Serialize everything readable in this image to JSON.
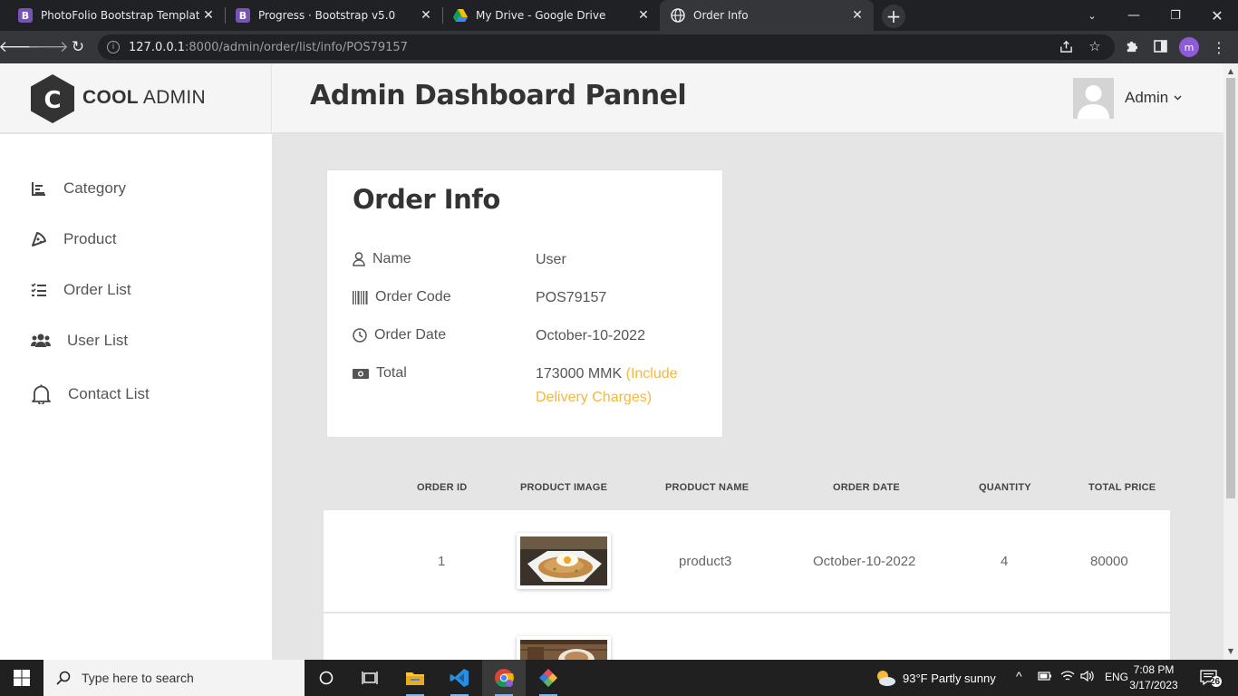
{
  "browser": {
    "tabs": [
      {
        "title": "PhotoFolio Bootstrap Template -",
        "icon": "bootstrap-icon",
        "favicon_letter": "B"
      },
      {
        "title": "Progress · Bootstrap v5.0",
        "icon": "bootstrap-icon",
        "favicon_letter": "B"
      },
      {
        "title": "My Drive - Google Drive",
        "icon": "google-drive-icon"
      },
      {
        "title": "Order Info",
        "icon": "globe-icon",
        "active": true
      }
    ],
    "url_host": "127.0.0.1",
    "url_rest": ":8000/admin/order/list/info/POS79157",
    "profile_initial": "m"
  },
  "brand": {
    "bold": "COOL",
    "light": "ADMIN",
    "mark": "C"
  },
  "header": {
    "title": "Admin Dashboard Pannel",
    "user": "Admin"
  },
  "sidebar": {
    "items": [
      {
        "label": "Category",
        "icon": "bar-chart-icon"
      },
      {
        "label": "Product",
        "icon": "pizza-icon"
      },
      {
        "label": "Order List",
        "icon": "list-check-icon"
      },
      {
        "label": "User List",
        "icon": "users-icon"
      },
      {
        "label": "Contact List",
        "icon": "bell-icon"
      }
    ]
  },
  "order_info": {
    "title": "Order Info",
    "rows": [
      {
        "label": "Name",
        "value": "User",
        "icon": "user-icon"
      },
      {
        "label": "Order Code",
        "value": "POS79157",
        "icon": "barcode-icon"
      },
      {
        "label": "Order Date",
        "value": "October-10-2022",
        "icon": "clock-icon"
      },
      {
        "label": "Total",
        "value": "173000 MMK",
        "note": "(Include Delivery Charges)",
        "icon": "money-icon"
      }
    ]
  },
  "table": {
    "headers": [
      "Order ID",
      "Product Image",
      "Product Name",
      "Order Date",
      "Quantity",
      "Total Price"
    ],
    "rows": [
      {
        "order_id": "1",
        "product_name": "product3",
        "order_date": "October-10-2022",
        "quantity": "4",
        "total_price": "80000",
        "image": "fried-rice-photo"
      }
    ]
  },
  "taskbar": {
    "search_placeholder": "Type here to search",
    "weather": "93°F  Partly sunny",
    "lang": "ENG",
    "time": "7:08 PM",
    "date": "3/17/2023",
    "notifications": "26"
  },
  "colors": {
    "accent_note": "#f4b740",
    "page_bg": "#e5e5e5",
    "heading": "#333333"
  }
}
